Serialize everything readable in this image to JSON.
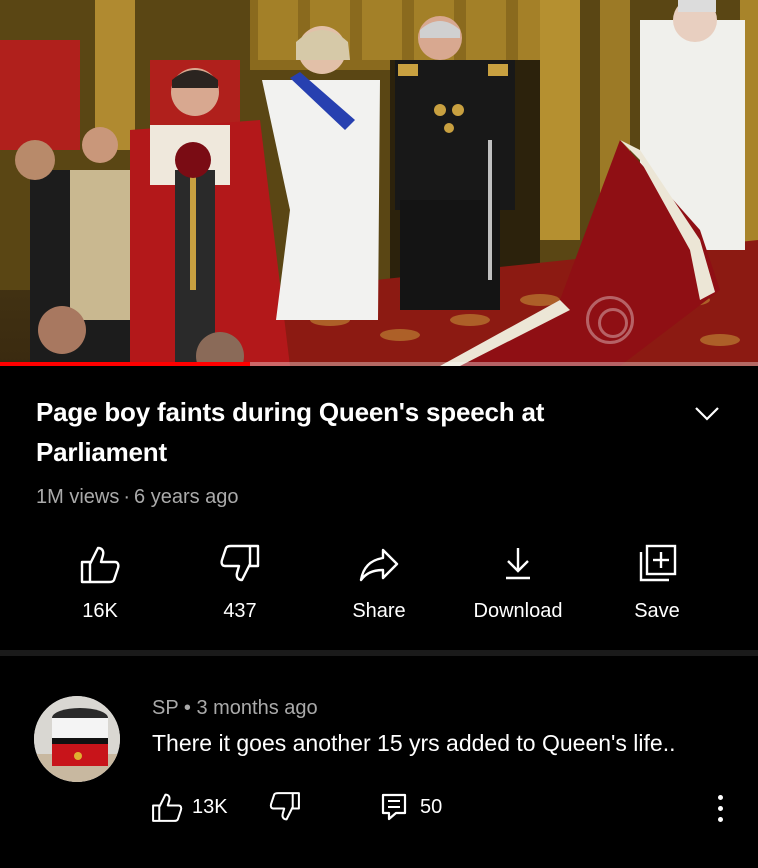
{
  "video": {
    "progress_fraction": 0.33,
    "colors": {
      "progress": "#ff0000"
    }
  },
  "title": "Page boy faints during Queen's speech at Parliament",
  "meta": {
    "views": "1M views",
    "age": "6 years ago"
  },
  "actions": {
    "like": {
      "label": "16K",
      "icon": "thumbs-up-icon"
    },
    "dislike": {
      "label": "437",
      "icon": "thumbs-down-icon"
    },
    "share": {
      "label": "Share",
      "icon": "share-arrow-icon"
    },
    "download": {
      "label": "Download",
      "icon": "download-icon"
    },
    "save": {
      "label": "Save",
      "icon": "add-to-playlist-icon"
    }
  },
  "comment": {
    "author": "SP",
    "age": "3 months ago",
    "text": "There it goes another 15 yrs added to Queen's life..",
    "likes": "13K",
    "replies": "50"
  }
}
